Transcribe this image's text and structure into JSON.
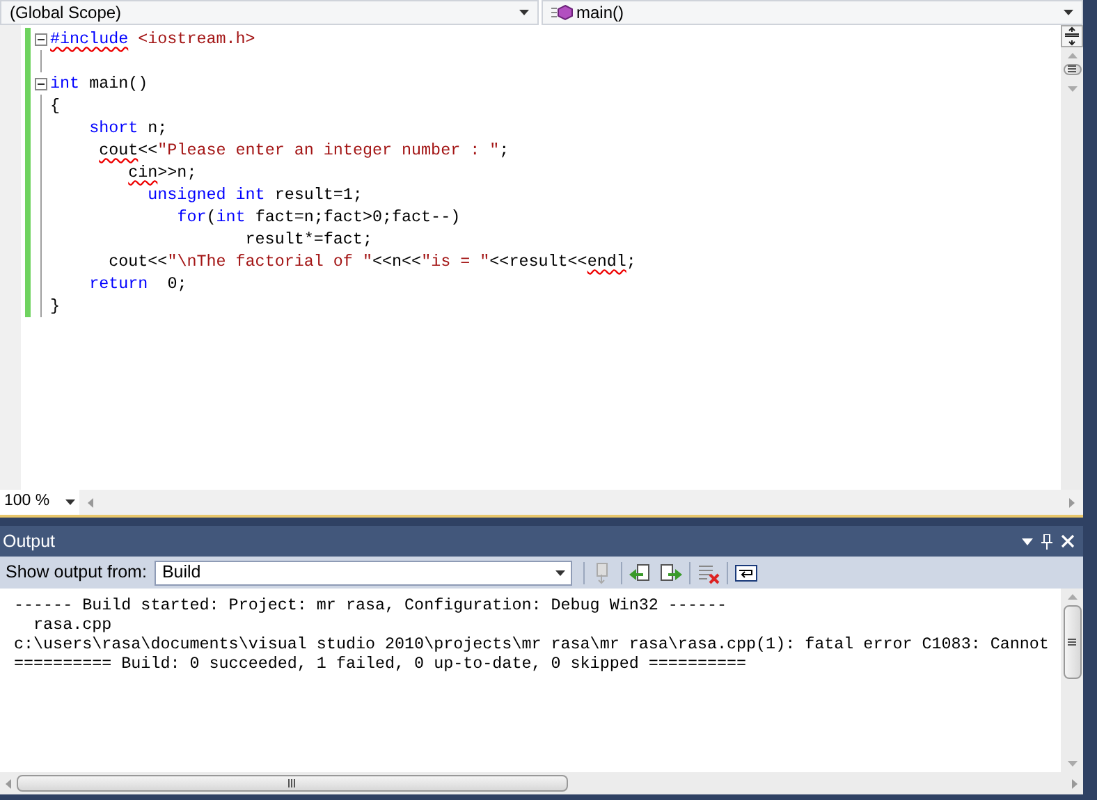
{
  "navigation_bar": {
    "scope": "(Global Scope)",
    "member": "main()"
  },
  "editor": {
    "lines": [
      {
        "changed": true,
        "fold": true,
        "tokens": [
          {
            "kind": "keyword",
            "text": "#include",
            "error": true
          },
          {
            "kind": "string",
            "text": " <iostream.h>"
          }
        ]
      },
      {
        "changed": true,
        "fold": false
      },
      {
        "changed": true,
        "fold": true,
        "tokens": [
          {
            "kind": "keyword",
            "text": "int"
          },
          {
            "kind": "text",
            "text": " main()"
          }
        ]
      },
      {
        "changed": true,
        "fold": false,
        "tokens": [
          {
            "kind": "text",
            "text": "{"
          }
        ]
      },
      {
        "changed": true,
        "fold": false,
        "tokens": [
          {
            "kind": "keyword",
            "text": "    short"
          },
          {
            "kind": "text",
            "text": " n;"
          }
        ]
      },
      {
        "changed": true,
        "fold": false,
        "tokens": [
          {
            "kind": "text",
            "text": "     cout",
            "error": true
          },
          {
            "kind": "text",
            "text": "<<"
          },
          {
            "kind": "string",
            "text": "\"Please enter an integer number : \""
          },
          {
            "kind": "text",
            "text": ";"
          }
        ]
      },
      {
        "changed": true,
        "fold": false,
        "tokens": [
          {
            "kind": "text",
            "text": "        cin",
            "error": true
          },
          {
            "kind": "text",
            "text": ">>n;"
          }
        ]
      },
      {
        "changed": true,
        "fold": false,
        "tokens": [
          {
            "kind": "keyword",
            "text": "          unsigned"
          },
          {
            "kind": "keyword",
            "text": " int"
          },
          {
            "kind": "text",
            "text": " result=1;"
          }
        ]
      },
      {
        "changed": true,
        "fold": false,
        "tokens": [
          {
            "kind": "keyword",
            "text": "             for"
          },
          {
            "kind": "text",
            "text": "("
          },
          {
            "kind": "keyword",
            "text": "int"
          },
          {
            "kind": "text",
            "text": " fact=n;fact>0;fact--)"
          }
        ]
      },
      {
        "changed": true,
        "fold": false,
        "tokens": [
          {
            "kind": "text",
            "text": "                    result*=fact;"
          }
        ]
      },
      {
        "changed": true,
        "fold": false,
        "tokens": [
          {
            "kind": "text",
            "text": "      cout<<"
          },
          {
            "kind": "string",
            "text": "\"\\nThe factorial of \""
          },
          {
            "kind": "text",
            "text": "<<n<<"
          },
          {
            "kind": "string",
            "text": "\"is = \""
          },
          {
            "kind": "text",
            "text": "<<result<<"
          },
          {
            "kind": "text",
            "text": "endl",
            "error": true
          },
          {
            "kind": "text",
            "text": ";"
          }
        ]
      },
      {
        "changed": true,
        "fold": false,
        "tokens": [
          {
            "kind": "keyword",
            "text": "    return"
          },
          {
            "kind": "text",
            "text": "  0;"
          }
        ]
      },
      {
        "changed": true,
        "fold": false,
        "tokens": [
          {
            "kind": "text",
            "text": "}"
          }
        ]
      }
    ],
    "zoom": "100 %"
  },
  "output": {
    "title": "Output",
    "show_output_from_label": "Show output from:",
    "source": "Build",
    "lines": [
      "------ Build started: Project: mr rasa, Configuration: Debug Win32 ------",
      "  rasa.cpp",
      "c:\\users\\rasa\\documents\\visual studio 2010\\projects\\mr rasa\\mr rasa\\rasa.cpp(1): fatal error C1083: Cannot",
      "========== Build: 0 succeeded, 1 failed, 0 up-to-date, 0 skipped =========="
    ]
  }
}
